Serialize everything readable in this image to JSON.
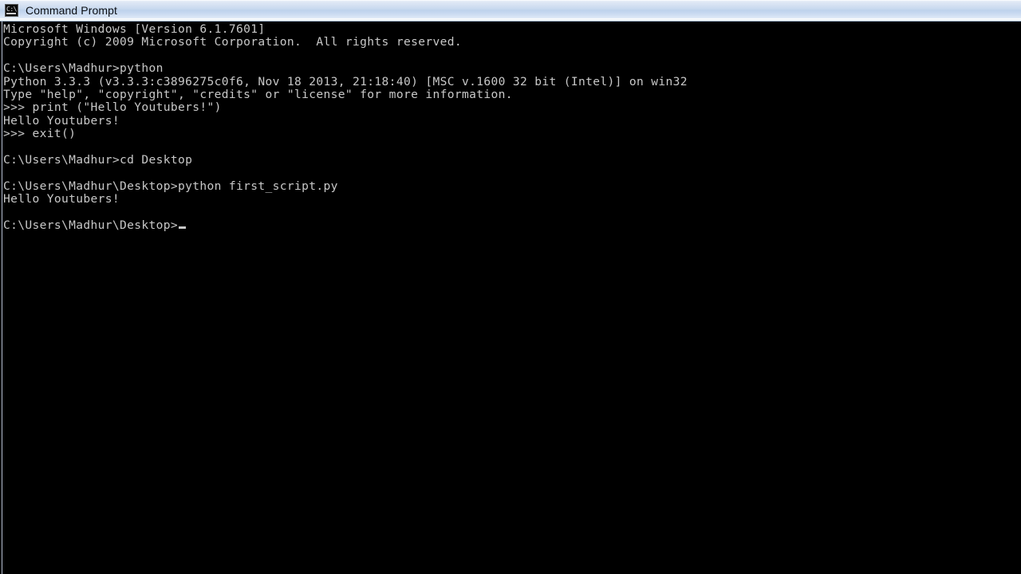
{
  "window": {
    "titlebar": {
      "title": "Command Prompt",
      "icon_name": "command-prompt-icon",
      "icon_glyph": "C:\\",
      "background_start": "#eef3fa",
      "background_end": "#ffffff",
      "text_color": "#0b0f14"
    }
  },
  "console": {
    "background_color": "#000000",
    "text_color": "#c8c8c8",
    "cursor": "_",
    "lines": [
      {
        "id": "line-1",
        "text": "Microsoft Windows [Version 6.1.7601]"
      },
      {
        "id": "line-2",
        "text": "Copyright (c) 2009 Microsoft Corporation.  All rights reserved."
      },
      {
        "id": "line-3",
        "text": ""
      },
      {
        "id": "line-4",
        "text": "C:\\Users\\Madhur>python"
      },
      {
        "id": "line-5",
        "text": "Python 3.3.3 (v3.3.3:c3896275c0f6, Nov 18 2013, 21:18:40) [MSC v.1600 32 bit (Intel)] on win32"
      },
      {
        "id": "line-6",
        "text": "Type \"help\", \"copyright\", \"credits\" or \"license\" for more information."
      },
      {
        "id": "line-7",
        "text": ">>> print (\"Hello Youtubers!\")"
      },
      {
        "id": "line-8",
        "text": "Hello Youtubers!"
      },
      {
        "id": "line-9",
        "text": ">>> exit()"
      },
      {
        "id": "line-10",
        "text": ""
      },
      {
        "id": "line-11",
        "text": "C:\\Users\\Madhur>cd Desktop"
      },
      {
        "id": "line-12",
        "text": ""
      },
      {
        "id": "line-13",
        "text": "C:\\Users\\Madhur\\Desktop>python first_script.py"
      },
      {
        "id": "line-14",
        "text": "Hello Youtubers!"
      },
      {
        "id": "line-15",
        "text": ""
      },
      {
        "id": "line-16",
        "text": "C:\\Users\\Madhur\\Desktop>"
      }
    ]
  }
}
